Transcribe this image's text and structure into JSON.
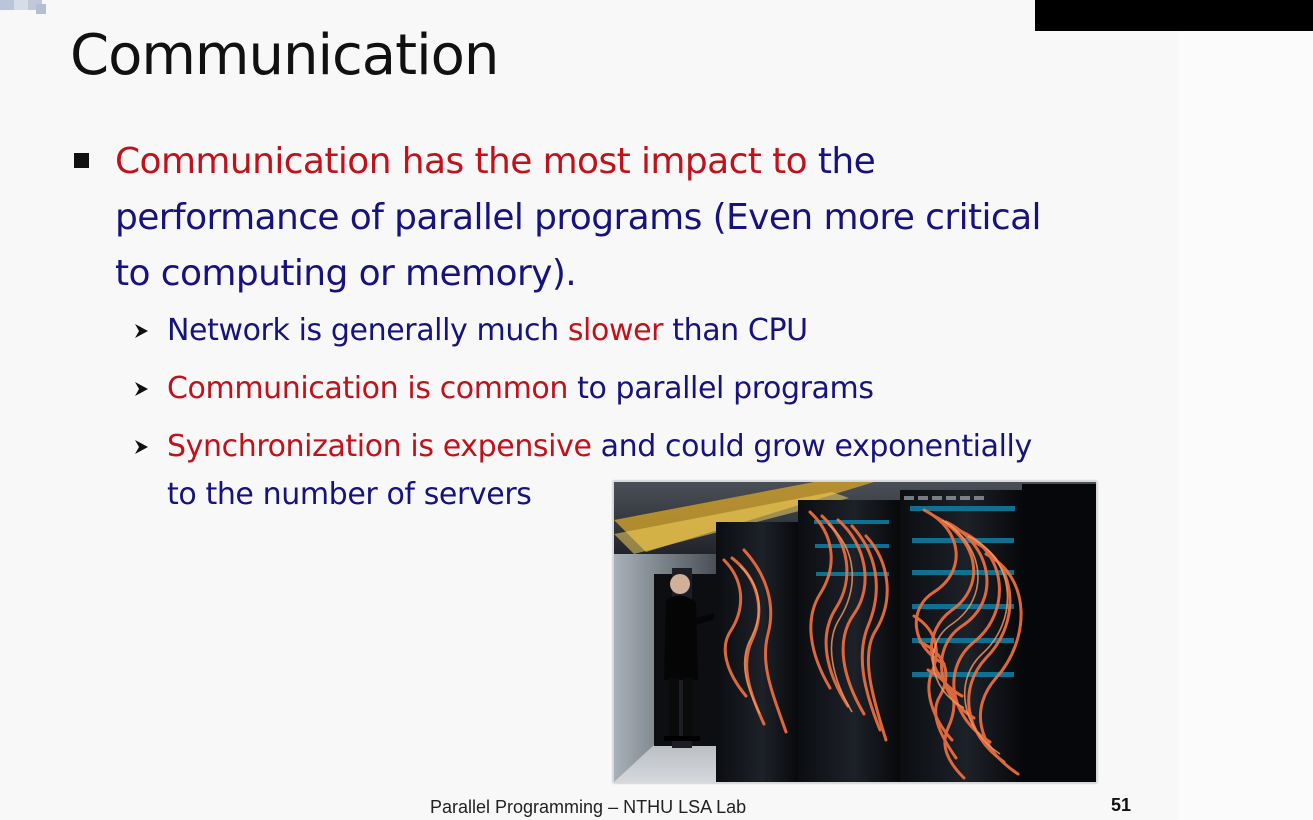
{
  "slide": {
    "title": "Communication",
    "main_bullet": {
      "lines": [
        [
          {
            "text": "Communication has the most impact to",
            "color": "red"
          },
          {
            "text": " the",
            "color": "blue"
          }
        ],
        [
          {
            "text": "performance of parallel programs (Even more critical",
            "color": "blue"
          }
        ],
        [
          {
            "text": "to computing or memory).",
            "color": "blue"
          }
        ]
      ]
    },
    "sub_bullets": [
      {
        "lines": [
          [
            {
              "text": "Network is generally much ",
              "color": "blue"
            },
            {
              "text": "slower",
              "color": "red"
            },
            {
              "text": " than CPU",
              "color": "blue"
            }
          ]
        ]
      },
      {
        "lines": [
          [
            {
              "text": "Communication is common",
              "color": "red"
            },
            {
              "text": " to parallel programs",
              "color": "blue"
            }
          ]
        ]
      },
      {
        "lines": [
          [
            {
              "text": "Synchronization is expensive",
              "color": "red"
            },
            {
              "text": " and could grow exponentially",
              "color": "blue"
            }
          ],
          [
            {
              "text": "to the number of servers",
              "color": "blue"
            }
          ]
        ]
      }
    ],
    "image": {
      "description": "photo-server-room"
    },
    "footer": {
      "center_text": "Parallel Programming – NTHU LSA Lab",
      "page_number": "51"
    }
  },
  "colors": {
    "red": "#c0121b",
    "blue": "#17137e",
    "title": "#111111",
    "background": "#f8f8f8"
  },
  "icons": {
    "main_bullet": "square-bullet-icon",
    "sub_bullet": "arrow-bullet-icon",
    "corner": "slide-corner-decoration-icon"
  }
}
